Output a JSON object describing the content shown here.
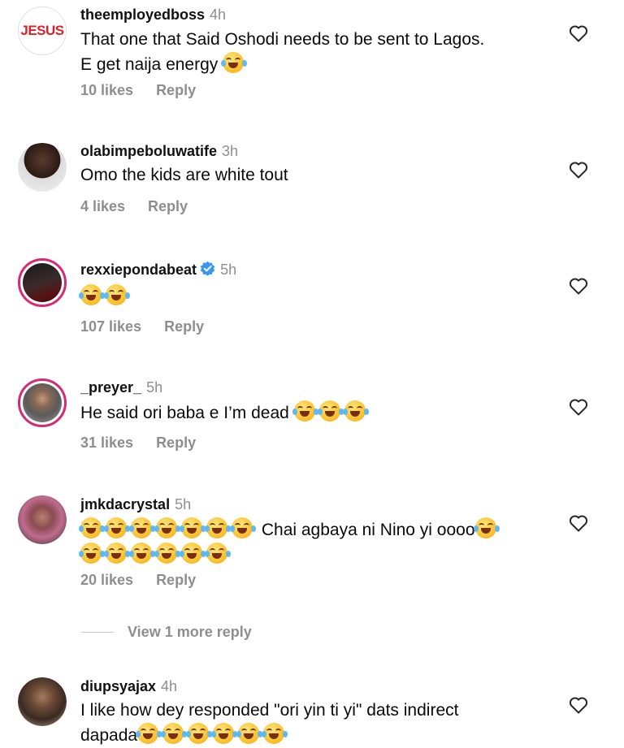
{
  "comments": [
    {
      "username": "theemployedboss",
      "time": "4h",
      "avatar_text": "JESUS",
      "lines": [
        "That one that Said Oshodi needs to be sent to Lagos.",
        "E get naija energy"
      ],
      "likes": "10 likes",
      "reply": "Reply"
    },
    {
      "username": "olabimpeboluwatife",
      "time": "3h",
      "lines": [
        "Omo the kids are white tout"
      ],
      "likes": "4 likes",
      "reply": "Reply"
    },
    {
      "username": "rexxiepondabeat",
      "time": "5h",
      "verified": true,
      "lines": [
        ""
      ],
      "likes": "107 likes",
      "reply": "Reply"
    },
    {
      "username": "_preyer_",
      "time": "5h",
      "lines": [
        "He said ori baba e I’m dead"
      ],
      "likes": "31 likes",
      "reply": "Reply"
    },
    {
      "username": "jmkdacrystal",
      "time": "5h",
      "lines": [
        "Chai agbaya ni Nino yi oooo"
      ],
      "likes": "20 likes",
      "reply": "Reply"
    },
    {
      "username": "diupsyajax",
      "time": "4h",
      "lines": [
        "I like how dey responded \"ori yin ti yi\" dats indirect",
        "dapada"
      ]
    }
  ],
  "view_more": "View 1 more reply",
  "emoji": "face-with-tears-of-joy",
  "colors": {
    "meta": "#8e8e8e",
    "verified": "#3897f0",
    "story_ring": "#d62976",
    "jesus_red": "#d8232a"
  }
}
